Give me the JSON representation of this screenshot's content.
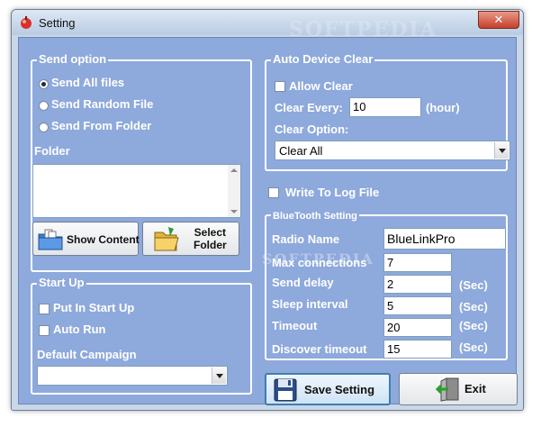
{
  "window": {
    "title": "Setting",
    "close_glyph": "✕",
    "watermark": "SOFTPEDIA"
  },
  "send_option": {
    "title": "Send option",
    "options": [
      {
        "label": "Send All files",
        "checked": true
      },
      {
        "label": "Send Random File",
        "checked": false
      },
      {
        "label": "Send From Folder",
        "checked": false
      }
    ],
    "folder_label": "Folder",
    "show_content_label": "Show Content",
    "select_folder_line1": "Select",
    "select_folder_line2": "Folder"
  },
  "start_up": {
    "title": "Start Up",
    "put_in_start_up": "Put In Start Up",
    "auto_run": "Auto Run",
    "default_campaign": "Default Campaign",
    "campaign_value": ""
  },
  "auto_device_clear": {
    "title": "Auto Device Clear",
    "allow_clear": "Allow Clear",
    "clear_every_label": "Clear Every:",
    "clear_every_value": "10",
    "clear_every_unit": "(hour)",
    "clear_option_label": "Clear Option:",
    "clear_option_value": "Clear All"
  },
  "write_log": "Write To Log File",
  "bluetooth": {
    "title": "BlueTooth Setting",
    "radio_name_label": "Radio Name",
    "radio_name_value": "BlueLinkPro",
    "max_connections_label": "Max connections",
    "max_connections_value": "7",
    "send_delay_label": "Send delay",
    "send_delay_value": "2",
    "sleep_interval_label": "Sleep interval",
    "sleep_interval_value": "5",
    "timeout_label": "Timeout",
    "timeout_value": "20",
    "discover_timeout_label": "Discover timeout",
    "discover_timeout_value": "15",
    "unit": "(Sec)"
  },
  "buttons": {
    "save": "Save Setting",
    "exit": "Exit"
  },
  "colors": {
    "panel": "#8ea9dc",
    "label_text": "#ffffff",
    "group_border": "#ffffff"
  }
}
